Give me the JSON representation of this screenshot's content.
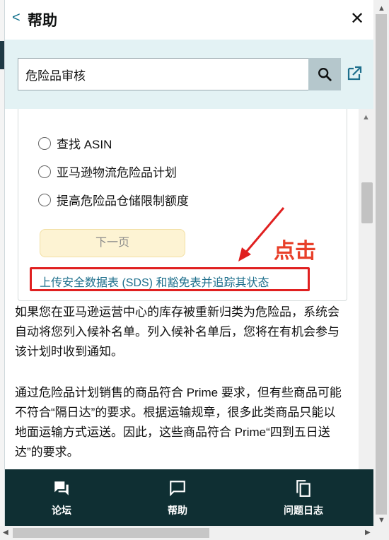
{
  "header": {
    "back_symbol": "<",
    "title": "帮助",
    "close_symbol": "✕"
  },
  "search": {
    "value": "危险品审核",
    "placeholder": ""
  },
  "options": [
    {
      "label": "查找 ASIN"
    },
    {
      "label": "亚马逊物流危险品计划"
    },
    {
      "label": "提高危险品仓储限制额度"
    }
  ],
  "next_button": {
    "label": "下一页"
  },
  "sds_link": {
    "label": "上传安全数据表 (SDS) 和豁免表并追踪其状态"
  },
  "annotation": {
    "text": "点击",
    "color": "#e8402a"
  },
  "paragraphs": [
    "如果您在亚马逊运营中心的库存被重新归类为危险品，系统会自动将您列入候补名单。列入候补名单后，您将在有机会参与该计划时收到通知。",
    "通过危险品计划销售的商品符合 Prime 要求，但有些商品可能不符合“隔日达”的要求。根据运输规章，很多此类商品只能以地面运输方式运送。因此，这些商品符合 Prime“四到五日送达”的要求。"
  ],
  "bottom_nav": [
    {
      "label": "论坛",
      "icon": "forum-icon"
    },
    {
      "label": "帮助",
      "icon": "help-chat-icon"
    },
    {
      "label": "问题日志",
      "icon": "case-log-icon"
    }
  ],
  "colors": {
    "accent_link": "#1e6f8c",
    "nav_bg": "#0f2f33",
    "search_band": "#e3f2f4",
    "highlight_red": "#e02020"
  }
}
